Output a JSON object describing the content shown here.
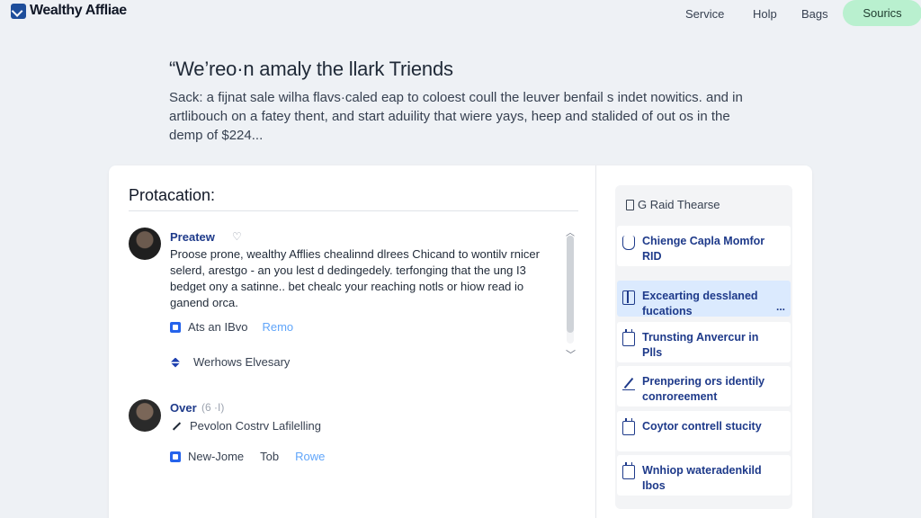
{
  "brand": {
    "name": "Wealthy Affliae",
    "logo_icon": "check-logo-icon"
  },
  "nav": {
    "links": [
      "Service",
      "Holp",
      "Bags"
    ],
    "cta": "Sourics",
    "cta_color": "#b9f0cf"
  },
  "hero": {
    "headline": "“We’reo·n amaly the llark Triends",
    "lede": "Sack: a fijnat sale wilha flavs·caled eap to coloest coull the leuver benfail s indet nowitics. and in artlibouch on a fatey thent, and start aduility that wiere yays, heep and stalided of out os in the demp of $224..."
  },
  "main": {
    "section_title": "Protacation:",
    "comments": [
      {
        "author": "Preatew",
        "tag": "♡",
        "body": "Proose prone, wealthy Afflies chealinnd dlrees Chicand to wontilv rnicer selerd, arestgo - an you lest d dedingedely. terfonging that the ung I3 bedget ony a satinne.. bet chealc your reaching notls or hiow read io ganend orca.",
        "meta_text": "Ats an IBvo",
        "meta_link": "Remo",
        "extra": "Werhows Elvesary"
      },
      {
        "author": "Over",
        "tag": "(6 ·I)",
        "body": "Pevolon Costrv Lafilelling",
        "meta_text": "New-Jome",
        "meta_mid": "Tob",
        "meta_link": "Rowe"
      }
    ]
  },
  "sidebar": {
    "title": "G Raid Thearse",
    "items": [
      {
        "label": "Chienge Capla Momfor RID",
        "icon": "hand-icon"
      },
      {
        "label": "Excearting desslaned fucations",
        "icon": "columns-icon",
        "active": true,
        "more": "..."
      },
      {
        "label": "Trunsting Anvercur in Plls",
        "icon": "calendar-icon"
      },
      {
        "label": "Prenpering ors identily conroreement",
        "icon": "pen-icon"
      },
      {
        "label": "Coytor contrell stucity",
        "icon": "calendar-icon"
      },
      {
        "label": "Wnhiop wateradenkild Ibos",
        "icon": "calendar-icon"
      }
    ]
  },
  "colors": {
    "accent": "#1e3a8a",
    "link": "#60a5fa",
    "active_bg": "#dbeafe"
  }
}
